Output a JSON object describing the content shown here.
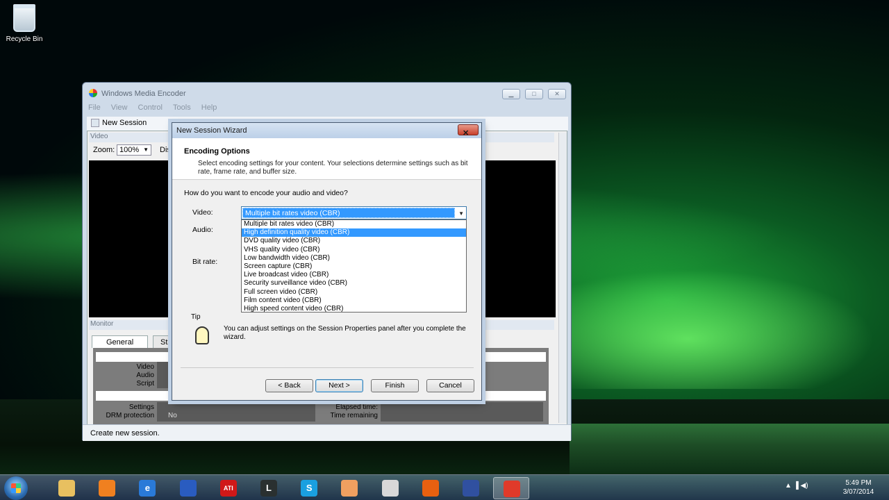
{
  "desktop": {
    "recycle_bin_label": "Recycle Bin"
  },
  "main_window": {
    "title": "Windows Media Encoder",
    "menu": [
      "File",
      "View",
      "Control",
      "Tools",
      "Help"
    ],
    "toolbar_new_session": "New Session",
    "video_panel_title": "Video",
    "zoom_label": "Zoom:",
    "zoom_value": "100%",
    "display_label_partial": "Disp",
    "monitor_panel_title": "Monitor",
    "monitor_tabs": [
      "General",
      "St"
    ],
    "monitor_labels": {
      "video": "Video",
      "audio": "Audio",
      "script": "Script",
      "settings": "Settings",
      "drm": "DRM protection",
      "drm_value": "No",
      "elapsed": "Elapsed time:",
      "remaining": "Time remaining"
    },
    "status_text": "Create new session."
  },
  "wizard": {
    "title": "New Session Wizard",
    "close_glyph": "✕",
    "heading": "Encoding Options",
    "description": "Select encoding settings for your content. Your selections determine settings such as bit rate, frame rate, and buffer size.",
    "question": "How do you want to encode your audio and video?",
    "video_label": "Video:",
    "audio_label": "Audio:",
    "bitrate_label": "Bit rate:",
    "video_selected": "Multiple bit rates video (CBR)",
    "options": [
      "Multiple bit rates video (CBR)",
      "High definition quality video (CBR)",
      "DVD quality video (CBR)",
      "VHS quality video (CBR)",
      "Low bandwidth video (CBR)",
      "Screen capture (CBR)",
      "Live broadcast video (CBR)",
      "Security surveillance video (CBR)",
      "Full screen video (CBR)",
      "Film content video (CBR)",
      "High speed content video (CBR)"
    ],
    "highlighted_index": 1,
    "tip_label": "Tip",
    "tip_text": "You can adjust settings on the Session Properties panel after you complete the wizard.",
    "buttons": {
      "back": "< Back",
      "next": "Next >",
      "finish": "Finish",
      "cancel": "Cancel"
    }
  },
  "taskbar": {
    "items": [
      {
        "icon": "explorer-folder-icon",
        "label": "",
        "color": "#e8c060"
      },
      {
        "icon": "media-player-icon",
        "label": "",
        "color": "#f08020"
      },
      {
        "icon": "internet-explorer-icon",
        "label": "e",
        "color": "#2a7ad8"
      },
      {
        "icon": "globe-app-icon",
        "label": "",
        "color": "#2a5cc0"
      },
      {
        "icon": "ati-icon",
        "label": "ATI",
        "color": "#d01818"
      },
      {
        "icon": "league-icon",
        "label": "L",
        "color": "#2a3030"
      },
      {
        "icon": "skype-icon",
        "label": "S",
        "color": "#1aa0e0"
      },
      {
        "icon": "notes-app-icon",
        "label": "",
        "color": "#f0a060"
      },
      {
        "icon": "java-icon",
        "label": "",
        "color": "#d8d8d8"
      },
      {
        "icon": "firefox-icon",
        "label": "",
        "color": "#e86010"
      },
      {
        "icon": "settings-app-icon",
        "label": "",
        "color": "#3050a0"
      },
      {
        "icon": "chrome-icon",
        "label": "",
        "color": "#e03a2a"
      }
    ],
    "clock_time": "5:49 PM",
    "clock_date": "3/07/2014",
    "tray_glyphs": "▲  ▐  ◀)"
  }
}
